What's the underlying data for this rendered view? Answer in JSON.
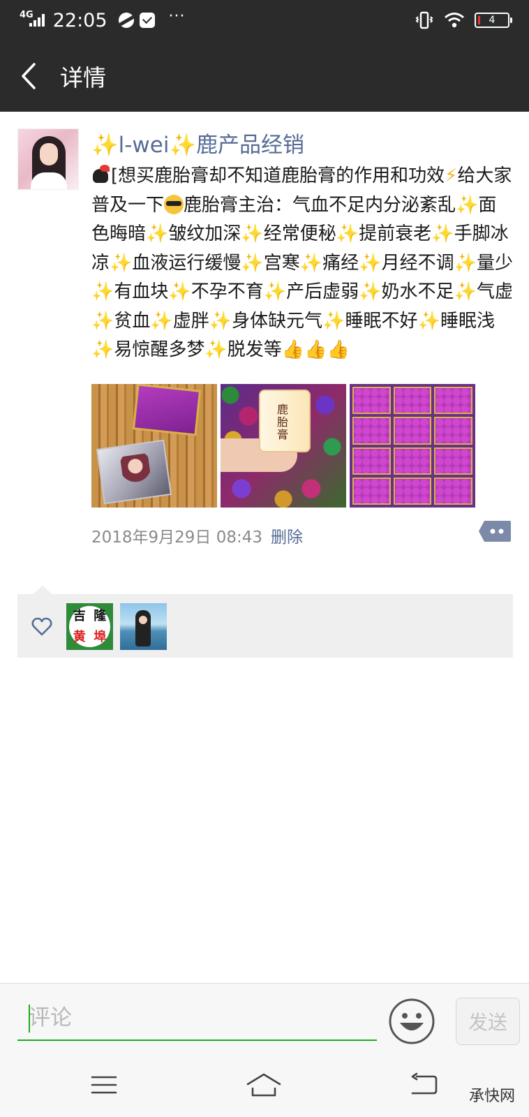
{
  "status_bar": {
    "network": "4G",
    "time": "22:05",
    "more": "···",
    "battery": "4"
  },
  "nav": {
    "title": "详情"
  },
  "post": {
    "username": "l-wei",
    "username_suffix": "鹿产品经销",
    "text_segments": [
      "[想买鹿胎膏却不知道鹿胎膏的作用和功效",
      "给大家普及一下",
      "鹿胎膏主治：气血不足内分泌紊乱",
      "面色晦暗",
      "皱纹加深",
      "经常便秘",
      "提前衰老",
      "手脚冰凉",
      "血液运行缓慢",
      "宫寒",
      "痛经",
      "月经不调",
      "量少",
      "有血块",
      "不孕不育",
      "产后虚弱",
      "奶水不足",
      "气虚",
      "贫血",
      "虚胖",
      "身体缺元气",
      "睡眠不好",
      "睡眠浅",
      "易惊醒多梦",
      "脱发等"
    ],
    "emoji": {
      "sparkle": "✨",
      "bolt": "⚡",
      "thumb": "👍"
    },
    "photos": [
      "photo-box-and-pack",
      "photo-jar-in-hand",
      "photo-trays"
    ],
    "timestamp": "2018年9月29日 08:43",
    "delete_label": "删除"
  },
  "likes": {
    "likers": [
      {
        "name": "liker-jilong",
        "label_chars": [
          "吉",
          "隆",
          "黄",
          "埠"
        ]
      },
      {
        "name": "liker-beach"
      }
    ]
  },
  "comment": {
    "placeholder": "评论",
    "send_label": "发送"
  },
  "watermark": "承快网",
  "colors": {
    "header_bg": "#2b2b2b",
    "link_blue": "#576b95",
    "accent_green": "#1aad19",
    "likes_bg": "#efefef"
  }
}
